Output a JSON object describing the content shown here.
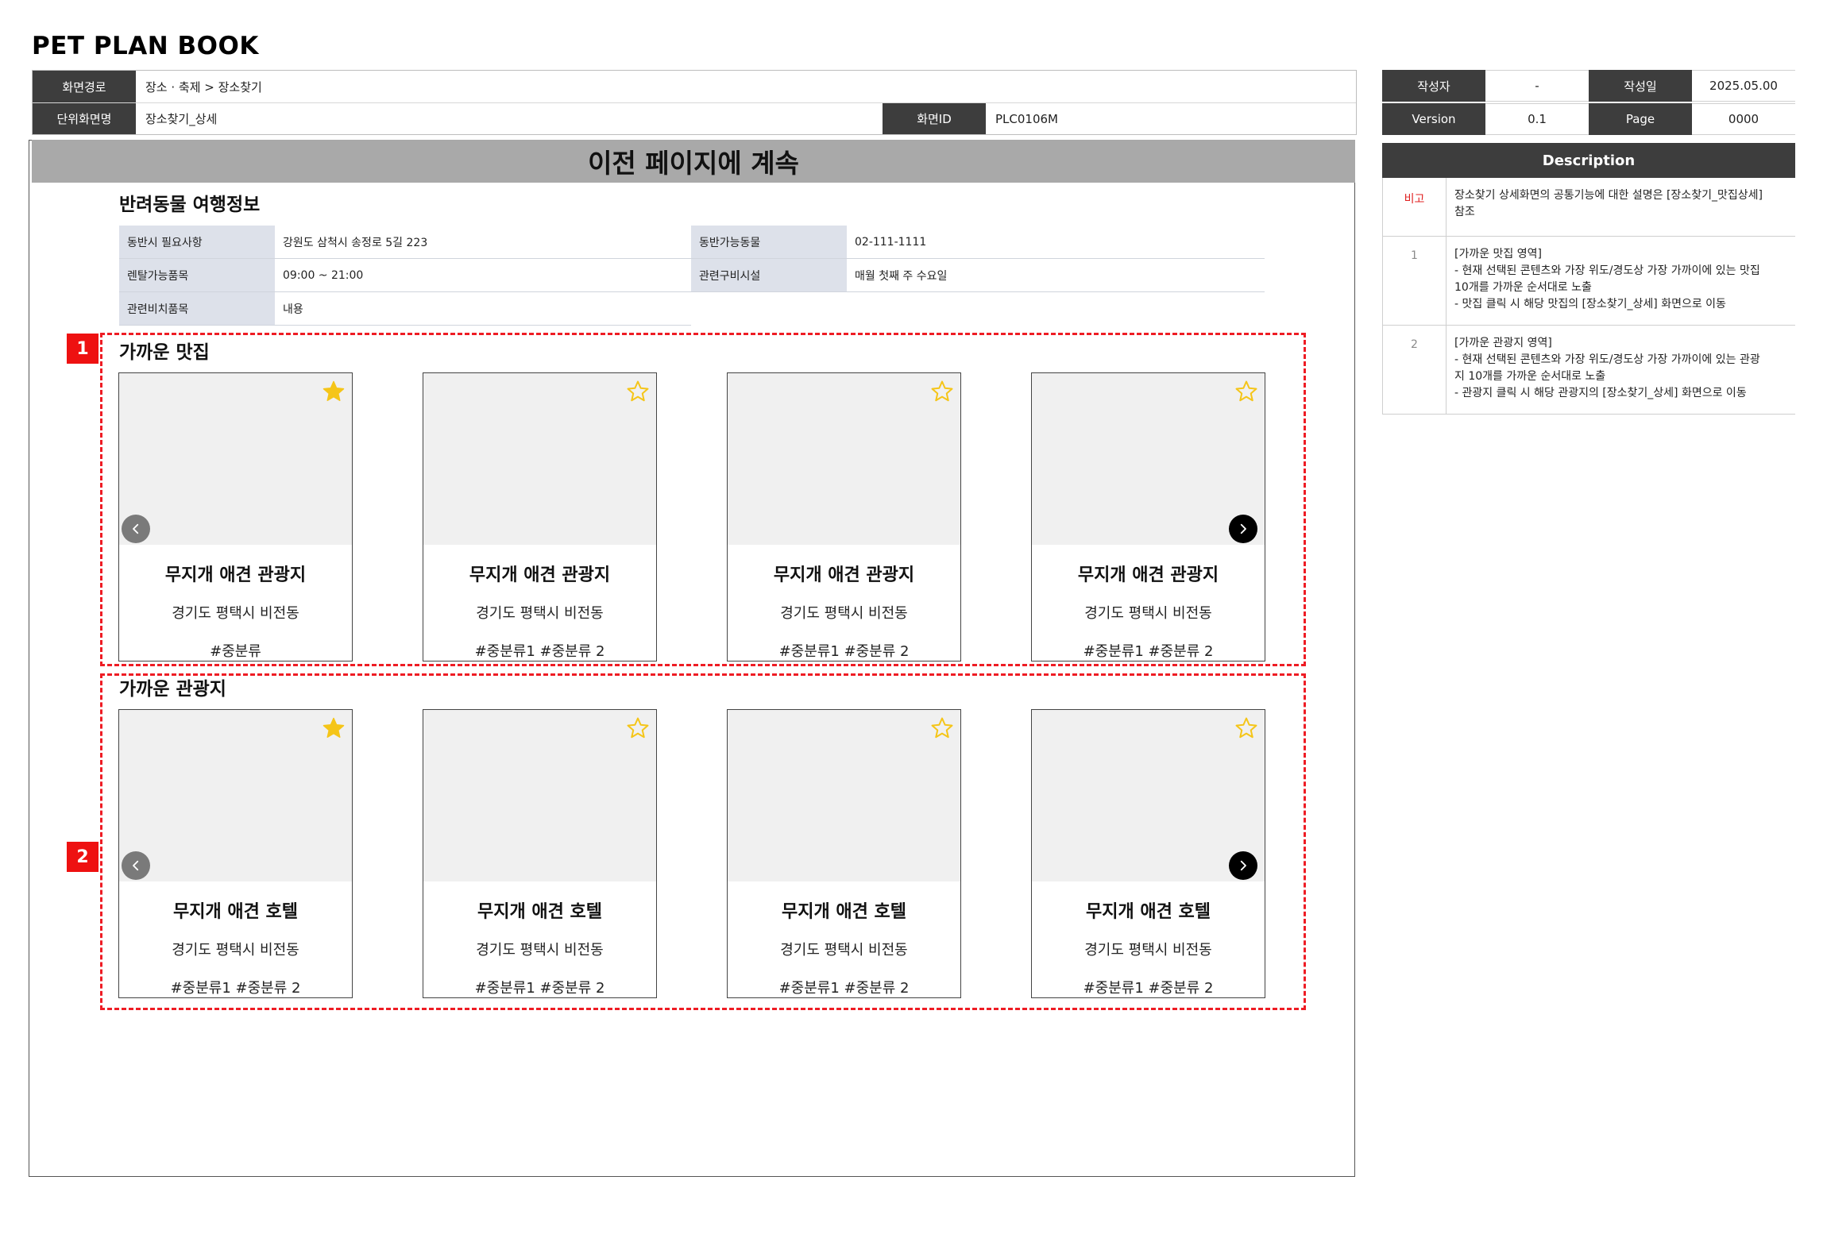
{
  "brand": "PET PLAN BOOK",
  "meta": {
    "path_label": "화면경로",
    "path_value": "장소 · 축제 > 장소찾기",
    "unit_label": "단위화면명",
    "unit_value": "장소찾기_상세",
    "id_label": "화면ID",
    "id_value": "PLC0106M",
    "author_label": "작성자",
    "author_value": "-",
    "date_label": "작성일",
    "date_value": "2025.05.00",
    "version_label": "Version",
    "version_value": "0.1",
    "page_label": "Page",
    "page_value": "0000"
  },
  "banner": "이전 페이지에 계속",
  "pet_info": {
    "title": "반려동물 여행정보",
    "rows": [
      {
        "l1": "동반시 필요사항",
        "v1": "강원도 삼척시 송정로 5길 223",
        "l2": "동반가능동물",
        "v2": "02-111-1111"
      },
      {
        "l1": "렌탈가능품목",
        "v1": "09:00 ~ 21:00",
        "l2": "관련구비시설",
        "v2": "매월 첫째 주 수요일"
      },
      {
        "l1": "관련비치품목",
        "v1": "내용"
      }
    ]
  },
  "restaurants": {
    "badge": "1",
    "title": "가까운 맛집",
    "cards": [
      {
        "title": "무지개 애견 관광지",
        "addr": "경기도 평택시 비전동",
        "tags": "#중분류",
        "starred": true
      },
      {
        "title": "무지개 애견 관광지",
        "addr": "경기도 평택시 비전동",
        "tags": "#중분류1 #중분류 2",
        "starred": false
      },
      {
        "title": "무지개 애견 관광지",
        "addr": "경기도 평택시 비전동",
        "tags": "#중분류1 #중분류 2",
        "starred": false
      },
      {
        "title": "무지개 애견 관광지",
        "addr": "경기도 평택시 비전동",
        "tags": "#중분류1 #중분류 2",
        "starred": false
      }
    ]
  },
  "attractions": {
    "badge": "2",
    "title": "가까운 관광지",
    "cards": [
      {
        "title": "무지개 애견 호텔",
        "addr": "경기도 평택시 비전동",
        "tags": "#중분류1 #중분류 2",
        "starred": true
      },
      {
        "title": "무지개 애견 호텔",
        "addr": "경기도 평택시 비전동",
        "tags": "#중분류1 #중분류 2",
        "starred": false
      },
      {
        "title": "무지개 애견 호텔",
        "addr": "경기도 평택시 비전동",
        "tags": "#중분류1 #중분류 2",
        "starred": false
      },
      {
        "title": "무지개 애견 호텔",
        "addr": "경기도 평택시 비전동",
        "tags": "#중분류1 #중분류 2",
        "starred": false
      }
    ]
  },
  "description": {
    "title": "Description",
    "rows": [
      {
        "key": "비고",
        "text": "장소찾기 상세화면의 공통기능에 대한 설명은 [장소찾기_맛집상세]\n참조"
      },
      {
        "key": "1",
        "text": "[가까운 맛집 영역]\n- 현재 선택된 콘텐츠와 가장 위도/경도상 가장 가까이에 있는 맛집\n10개를 가까운 순서대로 노출\n- 맛집 클릭 시 해당 맛집의 [장소찾기_상세] 화면으로 이동"
      },
      {
        "key": "2",
        "text": "[가까운 관광지 영역]\n- 현재 선택된 콘텐츠와 가장 위도/경도상 가장 가까이에 있는 관광\n지 10개를 가까운 순서대로 노출\n- 관광지 클릭 시 해당 관광지의 [장소찾기_상세] 화면으로 이동"
      }
    ]
  },
  "colors": {
    "star_filled": "#f5c518",
    "star_outline": "#f5c518",
    "badge": "#ee1111",
    "dashed_border": "#ee1c24"
  },
  "icons": {
    "star": "star-icon",
    "prev": "chevron-left-icon",
    "next": "chevron-right-icon"
  }
}
